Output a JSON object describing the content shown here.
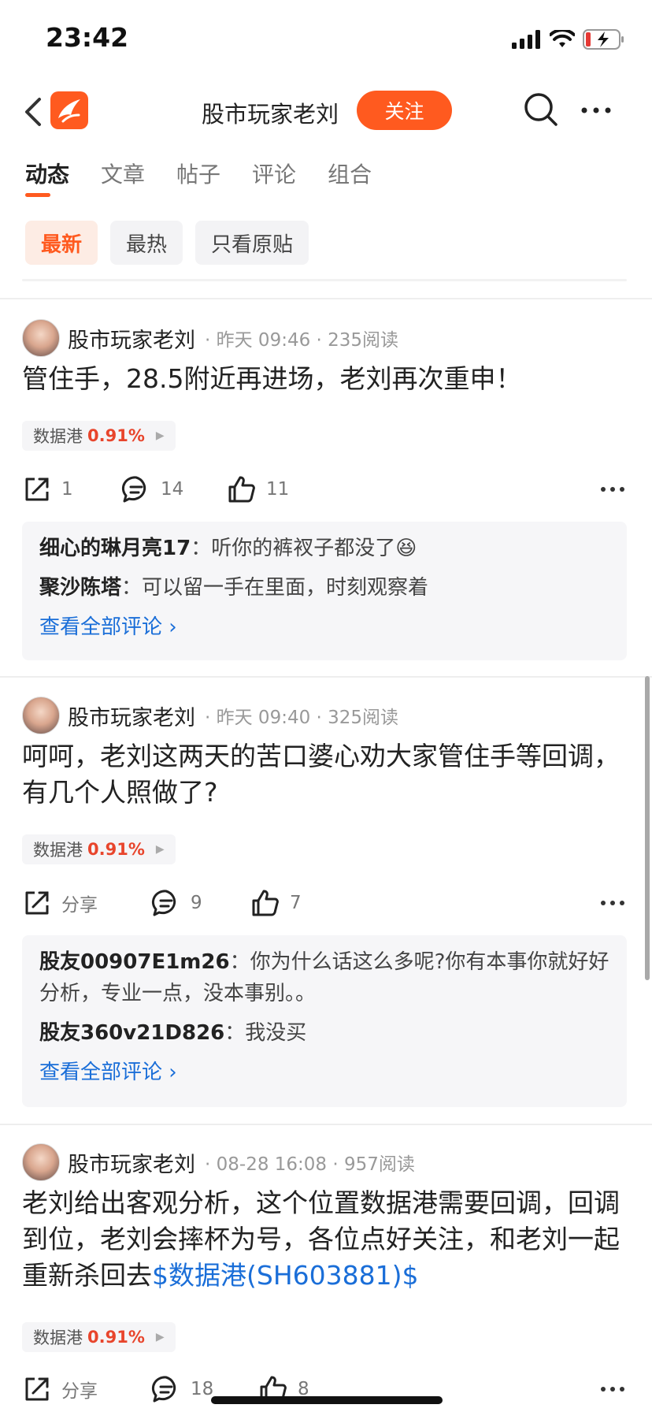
{
  "status_bar": {
    "time": "23:42"
  },
  "header": {
    "title": "股市玩家老刘",
    "follow_label": "关注"
  },
  "tabs": [
    {
      "label": "动态",
      "active": true
    },
    {
      "label": "文章"
    },
    {
      "label": "帖子"
    },
    {
      "label": "评论"
    },
    {
      "label": "组合"
    }
  ],
  "filters": [
    {
      "label": "最新",
      "active": true
    },
    {
      "label": "最热"
    },
    {
      "label": "只看原贴"
    }
  ],
  "posts": [
    {
      "author": "股市玩家老刘",
      "meta": "· 昨天 09:46 · 235阅读",
      "text": "管住手，28.5附近再进场，老刘再次重申！",
      "stock": {
        "name": "数据港",
        "change": "0.91%"
      },
      "share": "1",
      "comments_count": "14",
      "likes": "11",
      "comments": [
        {
          "user": "细心的琳月亮17",
          "sep": "：",
          "text": "听你的裤衩子都没了😆"
        },
        {
          "user": "聚沙陈塔",
          "sep": "：",
          "text": "可以留一手在里面，时刻观察着"
        }
      ],
      "view_all": "查看全部评论 ›"
    },
    {
      "author": "股市玩家老刘",
      "meta": "· 昨天 09:40 · 325阅读",
      "text": "呵呵，老刘这两天的苦口婆心劝大家管住手等回调，有几个人照做了?",
      "stock": {
        "name": "数据港",
        "change": "0.91%"
      },
      "share": "分享",
      "comments_count": "9",
      "likes": "7",
      "comments": [
        {
          "user": "股友00907E1m26",
          "sep": "：",
          "text": "你为什么话这么多呢?你有本事你就好好分析，专业一点，没本事别。。"
        },
        {
          "user": "股友360v21D826",
          "sep": "：",
          "text": "我没买"
        }
      ],
      "view_all": "查看全部评论 ›"
    },
    {
      "author": "股市玩家老刘",
      "meta": "· 08-28 16:08 · 957阅读",
      "text": "老刘给出客观分析，这个位置数据港需要回调，回调到位，老刘会摔杯为号，各位点好关注，和老刘一起重新杀回去",
      "link": "$数据港(SH603881)$",
      "stock": {
        "name": "数据港",
        "change": "0.91%"
      },
      "share": "分享",
      "comments_count": "18",
      "likes": "8"
    }
  ],
  "icons": {
    "back": "chevron-left-icon",
    "search": "search-icon",
    "more": "more-dots-icon",
    "share": "share-icon",
    "comment": "comment-icon",
    "like": "thumbs-up-icon"
  },
  "colors": {
    "accent": "#ff5a1f",
    "link": "#1a6ed8",
    "up": "#e8452c"
  }
}
